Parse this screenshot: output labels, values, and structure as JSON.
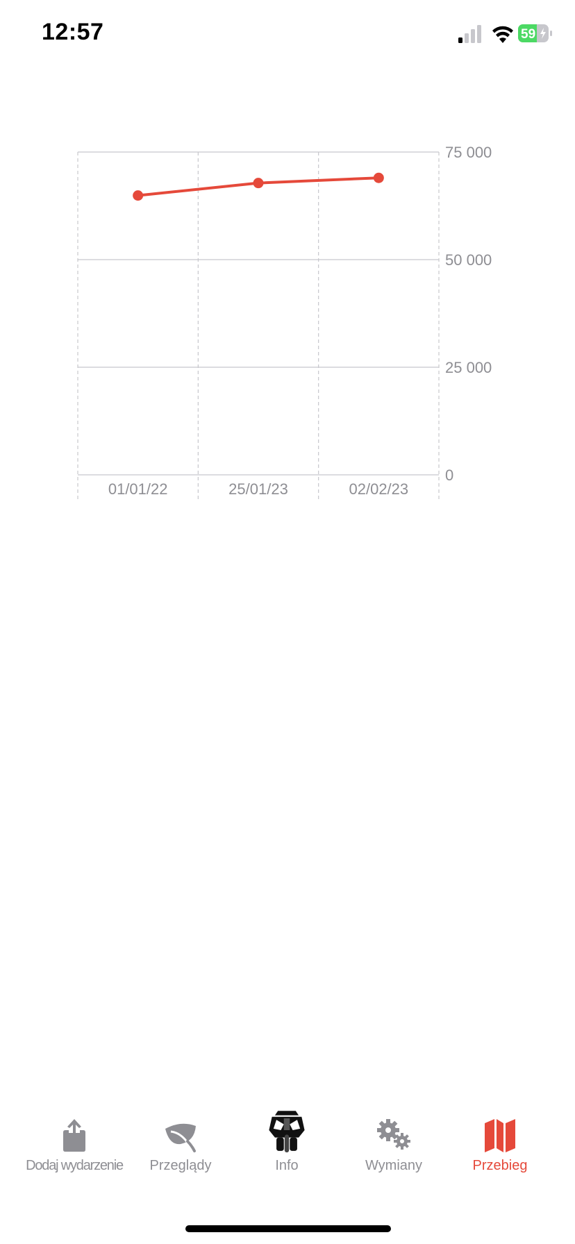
{
  "status_bar": {
    "time": "12:57",
    "battery_level": "59",
    "battery_charging": true,
    "icons": [
      "cellular-signal-icon",
      "wifi-icon",
      "battery-icon"
    ]
  },
  "chart_data": {
    "type": "line",
    "categories": [
      "01/01/22",
      "25/01/23",
      "02/02/23"
    ],
    "values": [
      64900,
      67800,
      69000
    ],
    "ylim": [
      0,
      75000
    ],
    "y_ticks": [
      0,
      25000,
      50000,
      75000
    ],
    "y_tick_labels": [
      "0",
      "25 000",
      "50 000",
      "75 000"
    ],
    "y_axis_side": "right",
    "grid": true,
    "line_color": "#e5493a",
    "title": "",
    "xlabel": "",
    "ylabel": ""
  },
  "tab_bar": {
    "active": "Przebieg",
    "active_color": "#e5493a",
    "inactive_color": "#8e8e93",
    "tabs": [
      {
        "label": "Dodaj wydarzenie",
        "icon": "share-icon"
      },
      {
        "label": "Przeglądy",
        "icon": "leaf-icon"
      },
      {
        "label": "Info",
        "icon": "motorcycle-icon"
      },
      {
        "label": "Wymiany",
        "icon": "gears-icon"
      },
      {
        "label": "Przebieg",
        "icon": "map-icon"
      }
    ]
  }
}
